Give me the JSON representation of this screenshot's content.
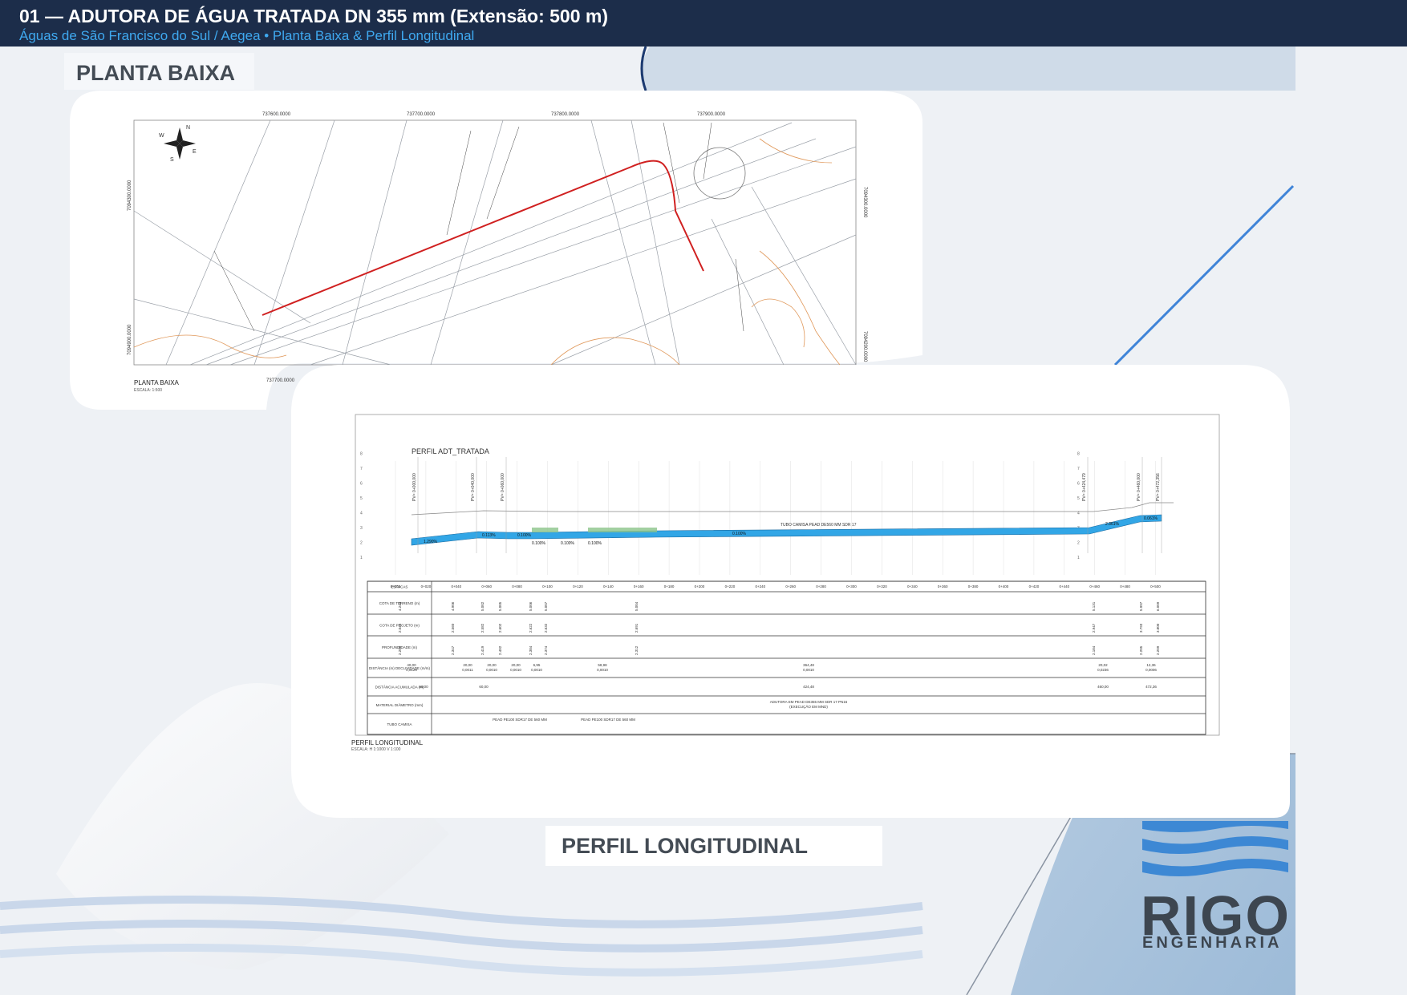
{
  "header": {
    "title": "01 — ADUTORA DE ÁGUA TRATADA DN 355 mm (Extensão: 500 m)",
    "subtitle": "Águas de São Francisco do Sul / Aegea • Planta Baixa & Perfil Longitudinal"
  },
  "sections": {
    "planta_label": "PLANTA BAIXA",
    "perfil_label": "PERFIL LONGITUDINAL"
  },
  "planta": {
    "coords_top": [
      "737600.0000",
      "737700.0000",
      "737800.0000",
      "737900.0000"
    ],
    "coord_bottom": "737700.0000",
    "coords_left": [
      "7094300.0000",
      "7094900.0000"
    ],
    "coords_right": [
      "7094300.0000",
      "7094200.0000"
    ],
    "caption": "PLANTA  BAIXA",
    "scale": "ESCALA: 1:500",
    "compass": [
      "N",
      "S",
      "E",
      "W"
    ]
  },
  "perfil": {
    "title": "PERFIL  ADT_TRATADA",
    "caption": "PERFIL  LONGITUDINAL",
    "scale": "ESCALA: H 1:1000  V 1:100",
    "y_ticks": [
      "1",
      "2",
      "3",
      "4",
      "5",
      "6",
      "7",
      "8"
    ],
    "pipe_note": "TUBO CAMISA PEAD DE560 MM SDR 17",
    "slopes": [
      "1.290%",
      "0.113%",
      "0.100%",
      "0.100%",
      "0.100%",
      "0.100%",
      "0.100%",
      "2.361%",
      "0.061%"
    ],
    "stations": [
      "0+000",
      "0+020",
      "0+040",
      "0+060",
      "0+080",
      "0+100",
      "0+120",
      "0+140",
      "0+160",
      "0+180",
      "0+200",
      "0+220",
      "0+240",
      "0+260",
      "0+280",
      "0+300",
      "0+320",
      "0+340",
      "0+360",
      "0+380",
      "0+400",
      "0+420",
      "0+440",
      "0+460",
      "0+480",
      "0+500"
    ],
    "rows": [
      {
        "label": "ESTACAS"
      },
      {
        "label": "COTA DE TERRENO (m)"
      },
      {
        "label": "COTA DE PROJETO (m)"
      },
      {
        "label": "PROFUNDIDADE (m)"
      },
      {
        "label": "DISTÂNCIA (m) DECLIVIDADE (m/m)"
      },
      {
        "label": "DISTÂNCIA ACUMULADA (m)"
      },
      {
        "label": "MATERIAL DIÂMETRO (mm)"
      },
      {
        "label": "TUBO CAMISA"
      }
    ],
    "cota_terreno": [
      "4.244",
      "4.906",
      "5.002",
      "5.005",
      "5.006",
      "5.007",
      "5.004",
      "5.131",
      "5.997",
      "6.009"
    ],
    "cota_projeto": [
      "2.044",
      "2.560",
      "2.582",
      "2.602",
      "2.622",
      "2.632",
      "2.691",
      "2.947",
      "3.793",
      "3.800"
    ],
    "profundidade": [
      "2.200",
      "2.347",
      "2.419",
      "2.402",
      "2.384",
      "2.374",
      "2.312",
      "2.184",
      "2.205",
      "2.209"
    ],
    "distancia": [
      "40,00",
      "20,00",
      "20,00",
      "20,00",
      "6,95",
      "58,98",
      "364,48",
      "20,02",
      "12,36"
    ],
    "declividade": [
      "0,0129",
      "0,0011",
      "0,0010",
      "0,0010",
      "0,0010",
      "0,0010",
      "0,0010",
      "0,0236",
      "0,0006"
    ],
    "dist_acumulada": [
      "40,00",
      "60,00",
      "424,48",
      "460,00",
      "472,36"
    ],
    "material": "ADUTORA EM PEAD DE355 MM SDR 17 PN16",
    "material_sub": "(EXECUÇÃO EM MND)",
    "tubo_camisa": "PEAD PE100 SDR17 DE 560 MM",
    "pv_labels": [
      "PV= 0+000,000",
      "PV= 0+040,000",
      "PV= 0+060,000",
      "PV= 0+424,479",
      "PV= 0+460,000",
      "PV= 0+472,356"
    ]
  },
  "logo": {
    "name": "RIGO",
    "sub": "ENGENHARIA"
  }
}
